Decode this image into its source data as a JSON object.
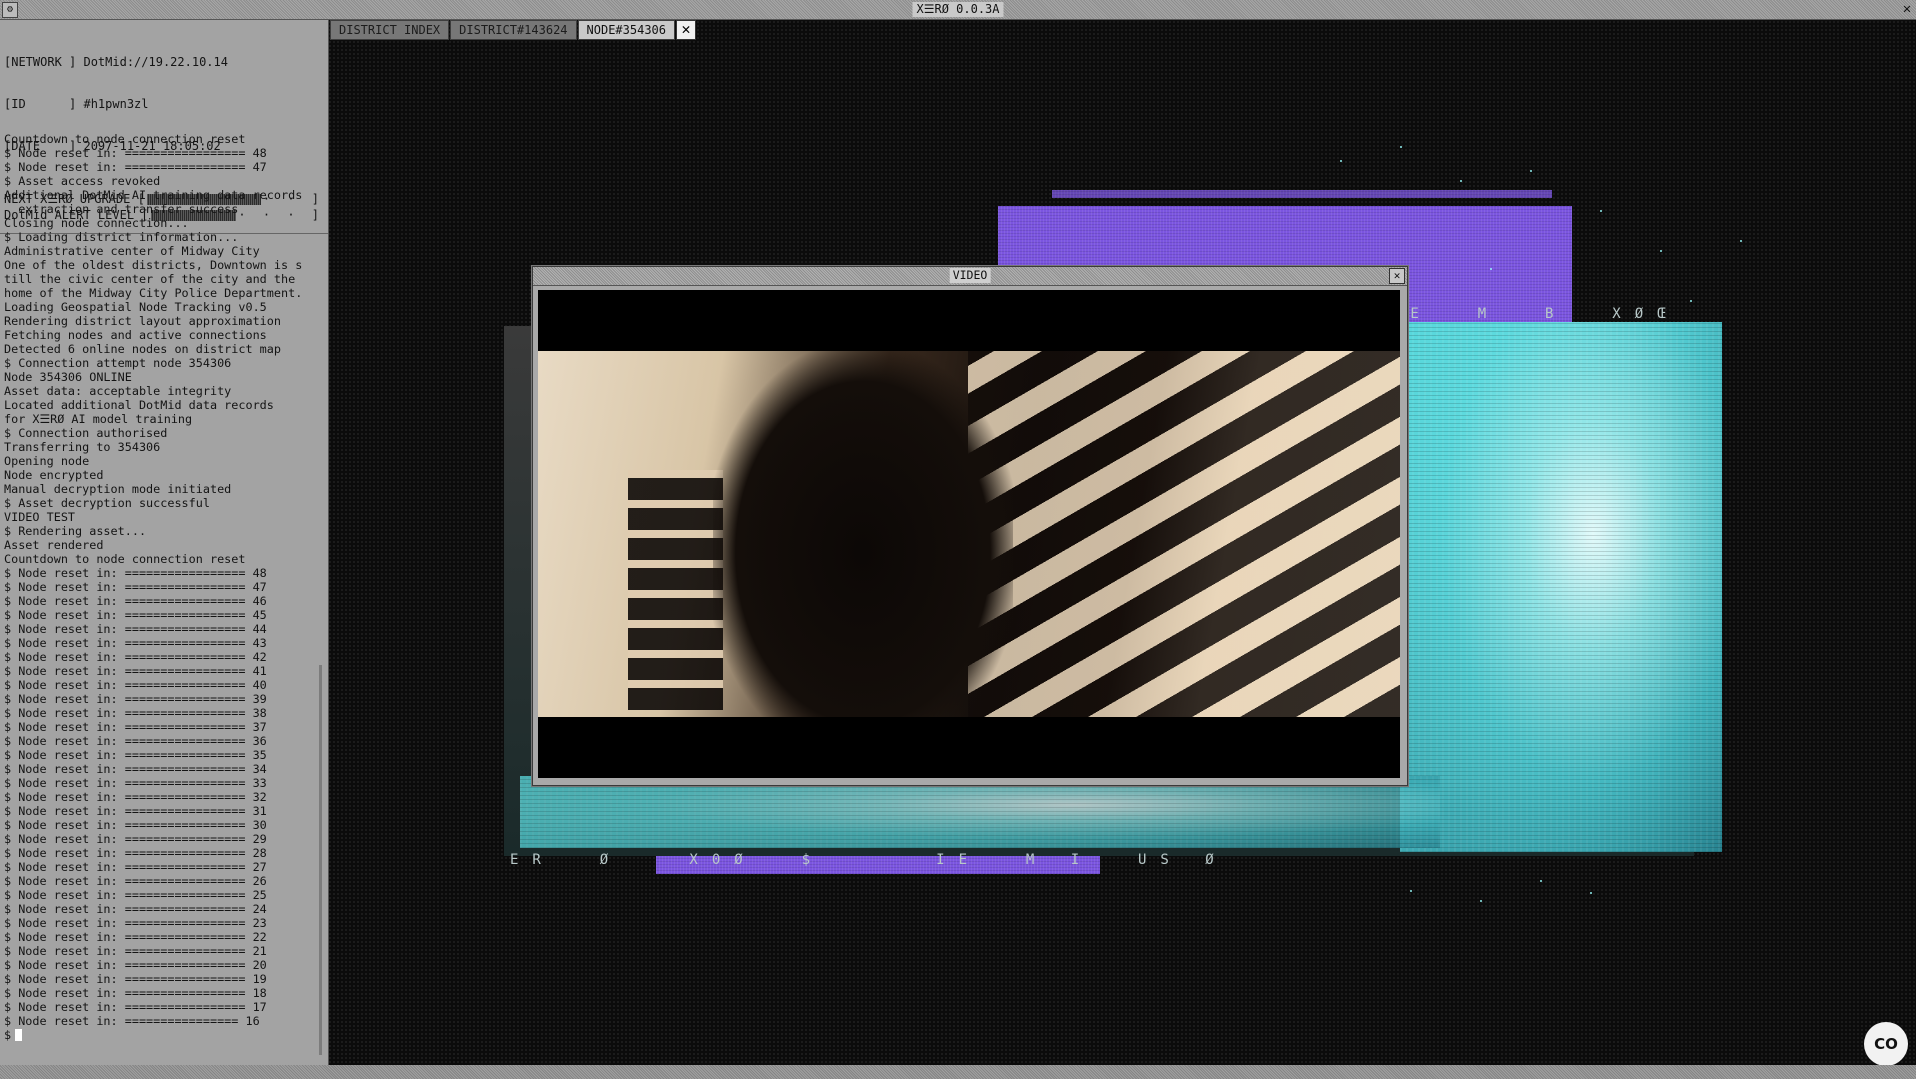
{
  "window": {
    "title": "X☰RØ 0.0.3A",
    "system_menu": "⚙",
    "close": "✕"
  },
  "info": {
    "network_label": "[NETWORK ]",
    "network_value": "DotMid://19.22.10.14",
    "id_label": "[ID      ]",
    "id_value": "#h1pwn3zl",
    "date_label": "[DATE    ]",
    "date_value": "2097-11-21 18:05:02"
  },
  "meters": {
    "upgrade_label": "NEXT X☰RØ UPGRADE [",
    "upgrade_tail": "· · ]",
    "alert_label": "DotMid ALERT LEVEL [",
    "alert_tail": "· · · ]"
  },
  "log": [
    "Countdown to node connection reset",
    "$ Node reset in: ================= 48",
    "$ Node reset in: ================= 47",
    "$ Asset access revoked",
    "Additional DotMid AI training data records",
    "  extraction and transfer success",
    "Closing node connection...",
    "$ Loading district information...",
    "Administrative center of Midway City",
    "One of the oldest districts, Downtown is s",
    "till the civic center of the city and the",
    "home of the Midway City Police Department.",
    "Loading Geospatial Node Tracking v0.5",
    "Rendering district layout approximation",
    "Fetching nodes and active connections",
    "Detected 6 online nodes on district map",
    "$ Connection attempt node 354306",
    "Node 354306 ONLINE",
    "Asset data: acceptable integrity",
    "Located additional DotMid data records",
    "for X☰RØ AI model training",
    "$ Connection authorised",
    "Transferring to 354306",
    "Opening node",
    "Node encrypted",
    "Manual decryption mode initiated",
    "$ Asset decryption successful",
    "VIDEO TEST",
    "$ Rendering asset...",
    "Asset rendered",
    "Countdown to node connection reset",
    "$ Node reset in: ================= 48",
    "$ Node reset in: ================= 47",
    "$ Node reset in: ================= 46",
    "$ Node reset in: ================= 45",
    "$ Node reset in: ================= 44",
    "$ Node reset in: ================= 43",
    "$ Node reset in: ================= 42",
    "$ Node reset in: ================= 41",
    "$ Node reset in: ================= 40",
    "$ Node reset in: ================= 39",
    "$ Node reset in: ================= 38",
    "$ Node reset in: ================= 37",
    "$ Node reset in: ================= 36",
    "$ Node reset in: ================= 35",
    "$ Node reset in: ================= 34",
    "$ Node reset in: ================= 33",
    "$ Node reset in: ================= 32",
    "$ Node reset in: ================= 31",
    "$ Node reset in: ================= 30",
    "$ Node reset in: ================= 29",
    "$ Node reset in: ================= 28",
    "$ Node reset in: ================= 27",
    "$ Node reset in: ================= 26",
    "$ Node reset in: ================= 25",
    "$ Node reset in: ================= 24",
    "$ Node reset in: ================= 23",
    "$ Node reset in: ================= 22",
    "$ Node reset in: ================= 21",
    "$ Node reset in: ================= 20",
    "$ Node reset in: ================= 19",
    "$ Node reset in: ================= 18",
    "$ Node reset in: ================= 17",
    "$ Node reset in: ================ 16"
  ],
  "prompt": "$",
  "tabs": [
    {
      "label": "DISTRICT INDEX",
      "active": false
    },
    {
      "label": "DISTRICT#143624",
      "active": false
    },
    {
      "label": "NODE#354306",
      "active": true
    }
  ],
  "tab_close": "✕",
  "glitch_text": {
    "row1": "ER  Ø   X0Ø  $     IE  M I  US Ø",
    "row2": "IE  M  B  XØŒ"
  },
  "video": {
    "title": "VIDEO",
    "close": "✕"
  },
  "cc_button": "CO",
  "colors": {
    "panel": "#a3a3a3",
    "purple": "#7b55e0",
    "cyan": "#4fd0d3",
    "background": "#0b0b0b"
  }
}
